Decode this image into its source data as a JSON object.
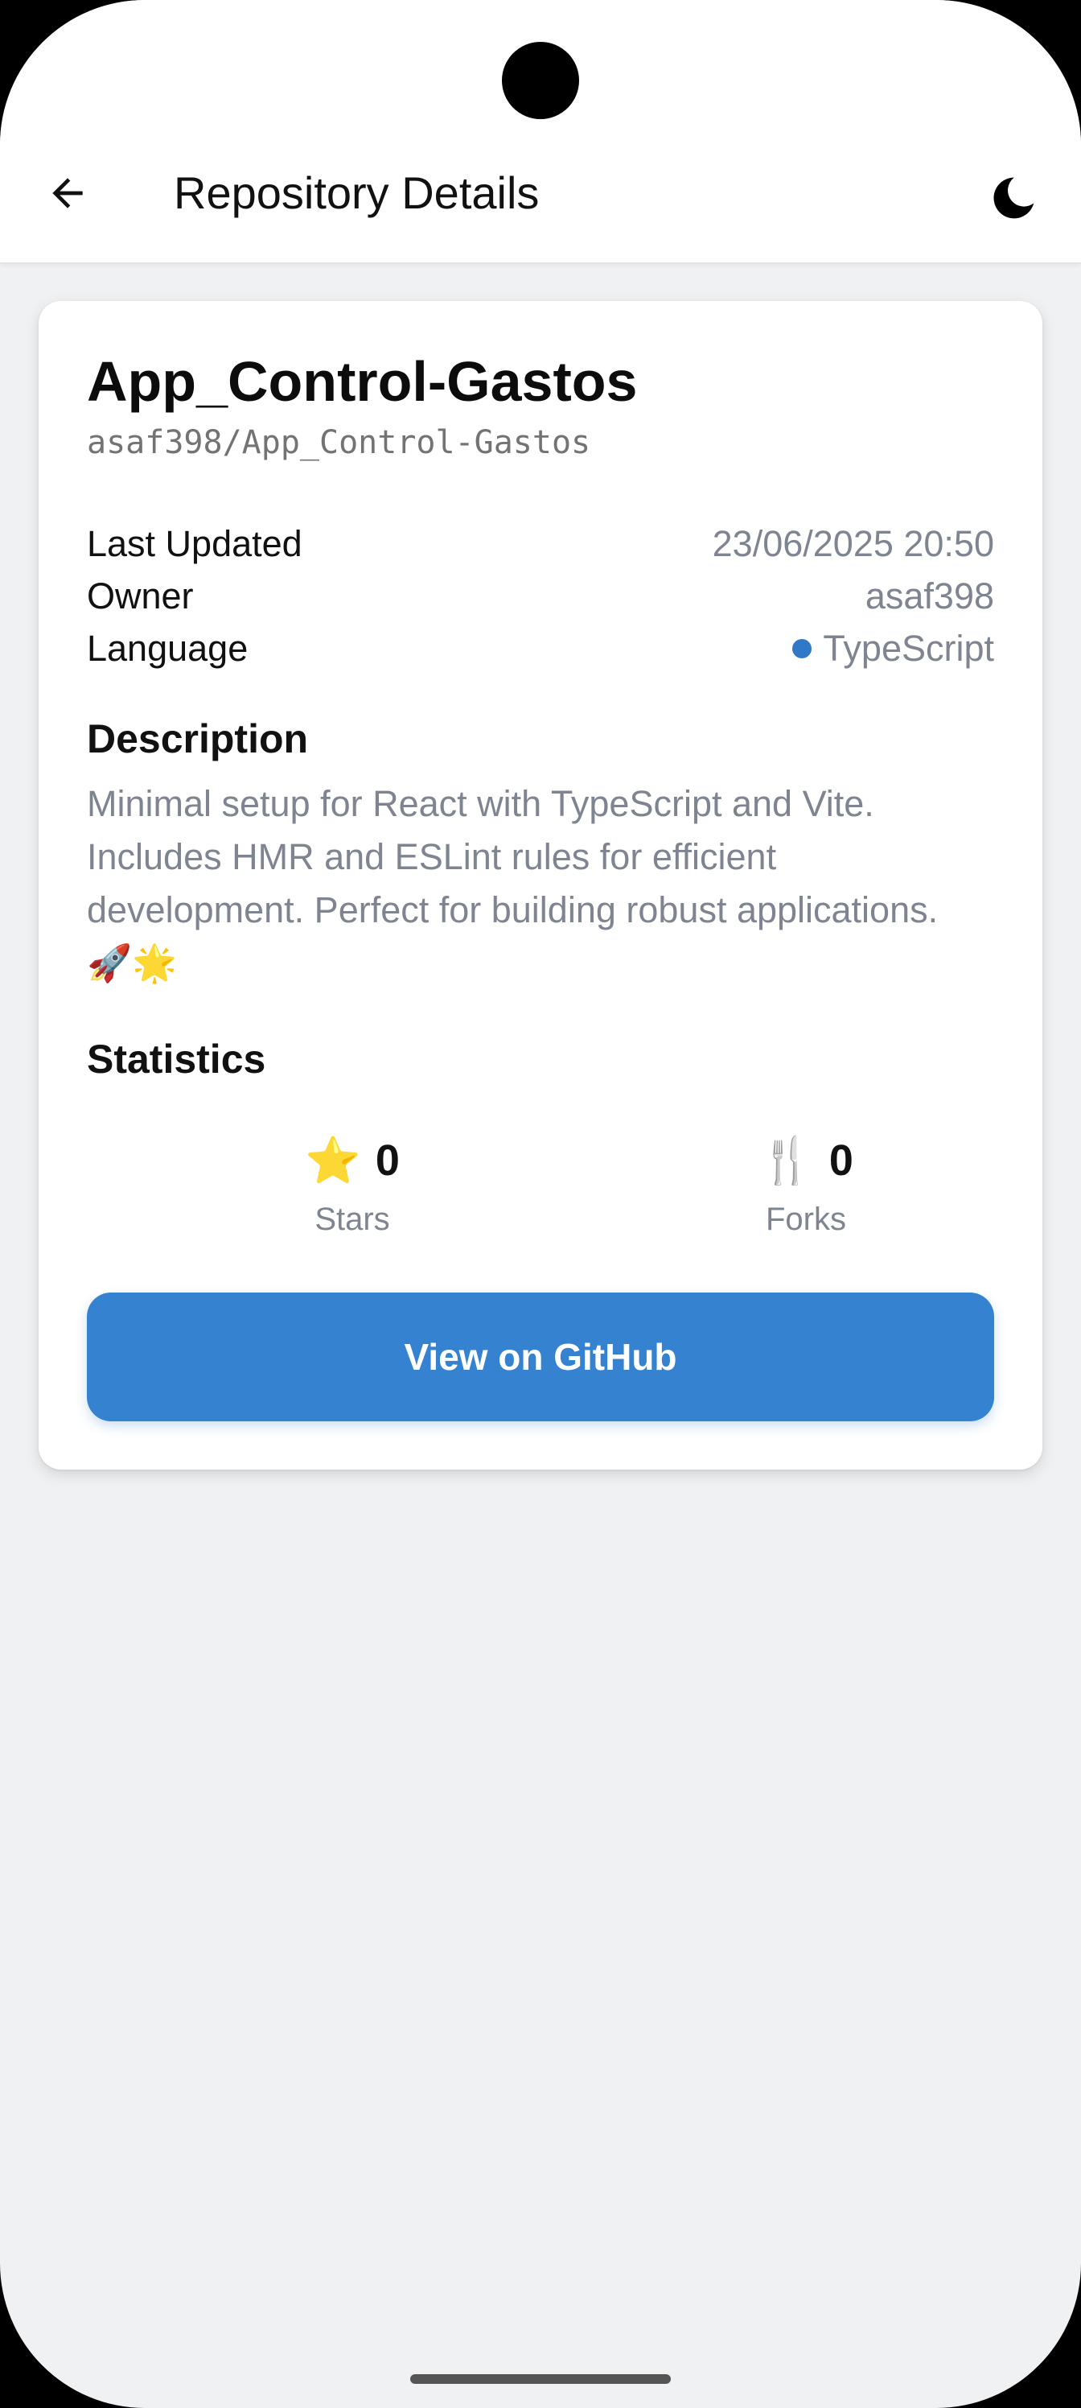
{
  "header": {
    "title": "Repository Details",
    "back_icon": "arrow-left-icon",
    "theme_icon": "moon-icon"
  },
  "repo": {
    "name": "App_Control-Gastos",
    "full_name": "asaf398/App_Control-Gastos"
  },
  "info": {
    "last_updated_label": "Last Updated",
    "last_updated_value": "23/06/2025 20:50",
    "owner_label": "Owner",
    "owner_value": "asaf398",
    "language_label": "Language",
    "language_value": "TypeScript",
    "language_color": "#3178c6"
  },
  "description": {
    "title": "Description",
    "text": "Minimal setup for React with TypeScript and Vite. Includes HMR and ESLint rules for efficient development. Perfect for building robust applications. 🚀🌟"
  },
  "statistics": {
    "title": "Statistics",
    "stars_icon": "⭐",
    "stars_value": "0",
    "stars_label": "Stars",
    "forks_icon": "🍴",
    "forks_value": "0",
    "forks_label": "Forks"
  },
  "actions": {
    "github_button_label": "View on GitHub",
    "button_color": "#3583d0"
  }
}
